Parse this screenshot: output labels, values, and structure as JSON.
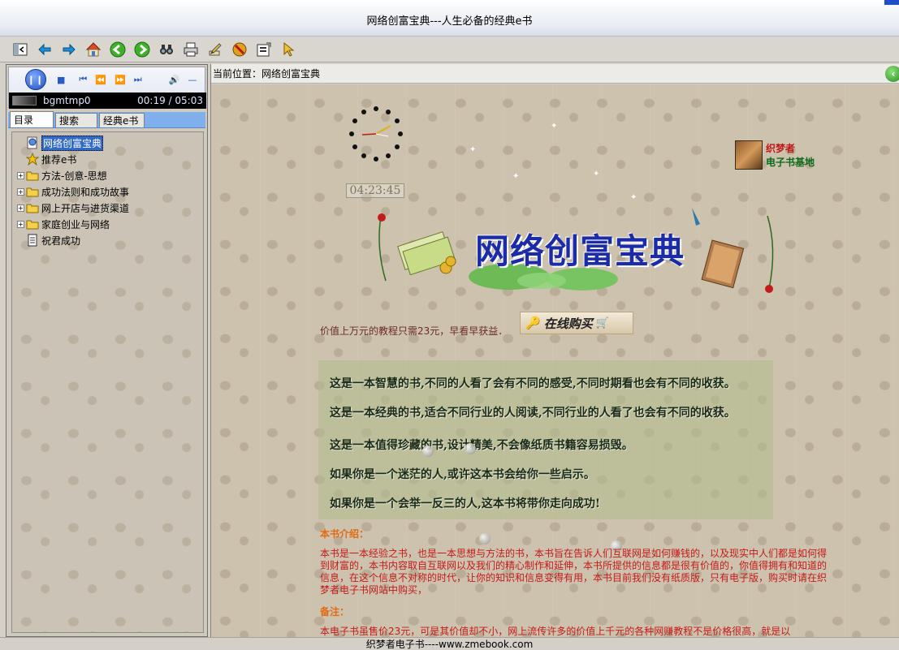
{
  "window": {
    "title": "网络创富宝典---人生必备的经典e书"
  },
  "toolbar": {
    "buttons": [
      {
        "name": "hide-pane",
        "icon": "hide-pane-icon"
      },
      {
        "name": "back",
        "icon": "arrow-left-icon"
      },
      {
        "name": "forward",
        "icon": "arrow-right-icon"
      },
      {
        "name": "home",
        "icon": "home-icon"
      },
      {
        "name": "previous",
        "icon": "green-back-icon"
      },
      {
        "name": "next",
        "icon": "green-forward-icon"
      },
      {
        "name": "find",
        "icon": "binoculars-icon"
      },
      {
        "name": "print",
        "icon": "printer-icon"
      },
      {
        "name": "edit",
        "icon": "pencil-icon"
      },
      {
        "name": "stop",
        "icon": "stop-sign-icon"
      },
      {
        "name": "options",
        "icon": "options-icon"
      },
      {
        "name": "pointer",
        "icon": "pointer-icon"
      }
    ]
  },
  "player": {
    "track": "bgmtmp0",
    "time": "00:19 / 05:03"
  },
  "tabs": [
    {
      "label": "目录",
      "active": true
    },
    {
      "label": "搜索",
      "active": false
    },
    {
      "label": "经典e书",
      "active": false
    }
  ],
  "tree": [
    {
      "label": "网络创富宝典",
      "icon": "globe-page-icon",
      "expandable": false,
      "selected": true
    },
    {
      "label": "推荐e书",
      "icon": "star-icon",
      "expandable": false,
      "selected": false
    },
    {
      "label": "方法-创意-思想",
      "icon": "folder-icon",
      "expandable": true,
      "selected": false
    },
    {
      "label": "成功法则和成功故事",
      "icon": "folder-icon",
      "expandable": true,
      "selected": false
    },
    {
      "label": "网上开店与进货渠道",
      "icon": "folder-icon",
      "expandable": true,
      "selected": false
    },
    {
      "label": "家庭创业与网络",
      "icon": "folder-icon",
      "expandable": true,
      "selected": false
    },
    {
      "label": "祝君成功",
      "icon": "document-icon",
      "expandable": false,
      "selected": false
    }
  ],
  "address": {
    "label": "当前位置：",
    "location": "网络创富宝典"
  },
  "page": {
    "digital_clock": "04:23:45",
    "logo_line1": "织梦者",
    "logo_line2": "电子书基地",
    "banner_title": "网络创富宝典",
    "price_text": "价值上万元的教程只需23元，早看早获益．",
    "buy_label": "在线购买",
    "wisdom": [
      "这是一本智慧的书,不同的人看了会有不同的感受,不同时期看也会有不同的收获。",
      "这是一本经典的书,适合不同行业的人阅读,不同行业的人看了也会有不同的收获。",
      "这是一本值得珍藏的书,设计精美,不会像纸质书籍容易损毁。",
      "如果你是一个迷茫的人,或许这本书会给你一些启示。",
      "如果你是一个会举一反三的人,这本书将带你走向成功!"
    ],
    "intro_heading": "本书介绍：",
    "intro_text": "本书是一本经验之书，也是一本思想与方法的书，本书旨在告诉人们互联网是如何赚钱的，以及现实中人们都是如何得到财富的，本书内容取自互联网以及我们的精心制作和延伸，本书所提供的信息都是很有价值的，你值得拥有和知道的信息，在这个信息不对称的时代，让你的知识和信息变得有用，本书目前我们没有纸质版，只有电子版，购买时请在织梦者电子书网站中购买，",
    "note_heading": "备注：",
    "note_text": "本电子书虽售价23元，可是其价值却不小，网上流传许多的价值上千元的各种网赚教程不是价格很高，就是以"
  },
  "status": {
    "text": "织梦者电子书----www.zmebook.com"
  },
  "colors": {
    "accent": "#316ac5",
    "intro_red": "#c41a1a",
    "heading_orange": "#e26a12",
    "banner_blue": "#1c2ca8"
  }
}
